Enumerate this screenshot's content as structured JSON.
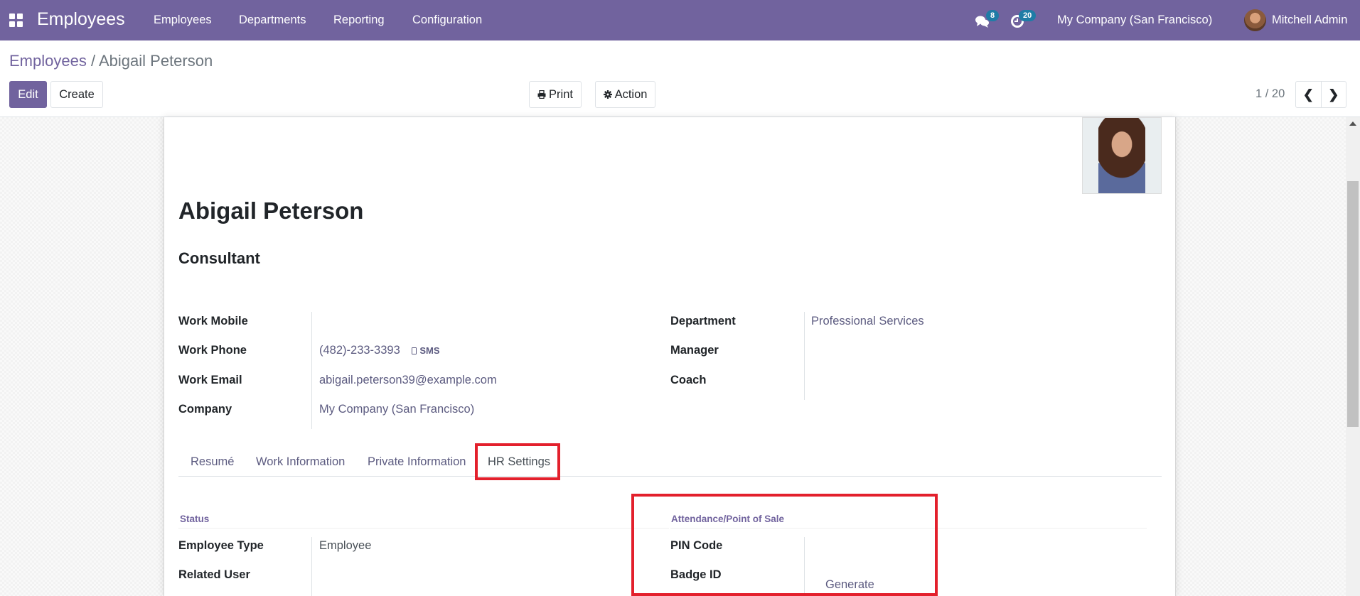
{
  "navbar": {
    "app_name": "Employees",
    "menu": [
      "Employees",
      "Departments",
      "Reporting",
      "Configuration"
    ],
    "messages_count": "8",
    "activities_count": "20",
    "company": "My Company (San Francisco)",
    "user": "Mitchell Admin"
  },
  "control_panel": {
    "breadcrumb": {
      "parent": "Employees",
      "separator": "/",
      "current": "Abigail Peterson"
    },
    "edit_label": "Edit",
    "create_label": "Create",
    "print_label": "Print",
    "action_label": "Action",
    "pager": "1 / 20"
  },
  "employee": {
    "name": "Abigail Peterson",
    "job_title": "Consultant",
    "left_fields": [
      {
        "label": "Work Mobile",
        "value": ""
      },
      {
        "label": "Work Phone",
        "value": "(482)-233-3393",
        "action": "SMS"
      },
      {
        "label": "Work Email",
        "value": "abigail.peterson39@example.com"
      },
      {
        "label": "Company",
        "value": "My Company (San Francisco)"
      }
    ],
    "right_fields": [
      {
        "label": "Department",
        "value": "Professional Services"
      },
      {
        "label": "Manager",
        "value": ""
      },
      {
        "label": "Coach",
        "value": ""
      }
    ]
  },
  "tabs": [
    {
      "label": "Resumé",
      "active": false
    },
    {
      "label": "Work Information",
      "active": false
    },
    {
      "label": "Private Information",
      "active": false
    },
    {
      "label": "HR Settings",
      "active": true
    }
  ],
  "hr_settings": {
    "status": {
      "title": "Status",
      "fields": [
        {
          "label": "Employee Type",
          "value": "Employee"
        },
        {
          "label": "Related User",
          "value": ""
        }
      ]
    },
    "attendance": {
      "title": "Attendance/Point of Sale",
      "fields": [
        {
          "label": "PIN Code",
          "value": ""
        },
        {
          "label": "Badge ID",
          "value": ""
        }
      ],
      "generate_label": "Generate"
    }
  },
  "highlight_color": "#e3202c",
  "brand_color": "#71639e"
}
